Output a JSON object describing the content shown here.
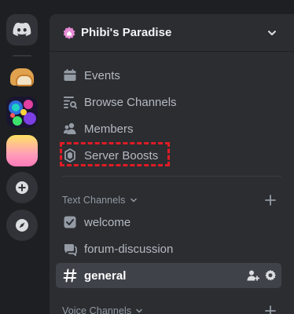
{
  "server": {
    "name": "Phibi's Paradise"
  },
  "nav": {
    "events": "Events",
    "browse_channels": "Browse Channels",
    "members": "Members",
    "server_boosts": "Server Boosts"
  },
  "categories": {
    "text": "Text Channels",
    "voice": "Voice Channels"
  },
  "channels": {
    "welcome": "welcome",
    "forum": "forum-discussion",
    "general": "general"
  },
  "colors": {
    "accent_highlight": "#e01b24",
    "boost_icon": "#ff73fa",
    "text_muted": "#b5bac1"
  }
}
